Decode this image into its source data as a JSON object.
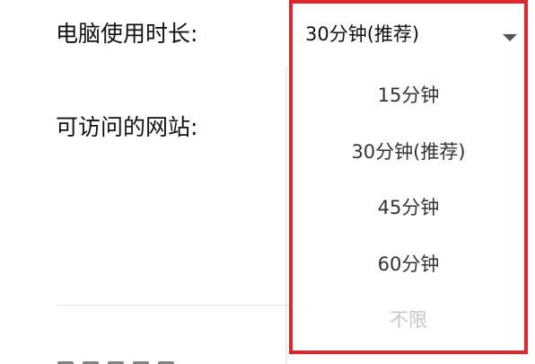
{
  "form": {
    "duration_label": "电脑使用时长:",
    "sites_label": "可访问的网站:"
  },
  "dropdown": {
    "selected": "30分钟(推荐)",
    "options": [
      "15分钟",
      "30分钟(推荐)",
      "45分钟",
      "60分钟",
      "不限"
    ]
  },
  "colors": {
    "highlight_border": "#e0262b"
  },
  "icons": {
    "caret": "caret-down-icon"
  }
}
